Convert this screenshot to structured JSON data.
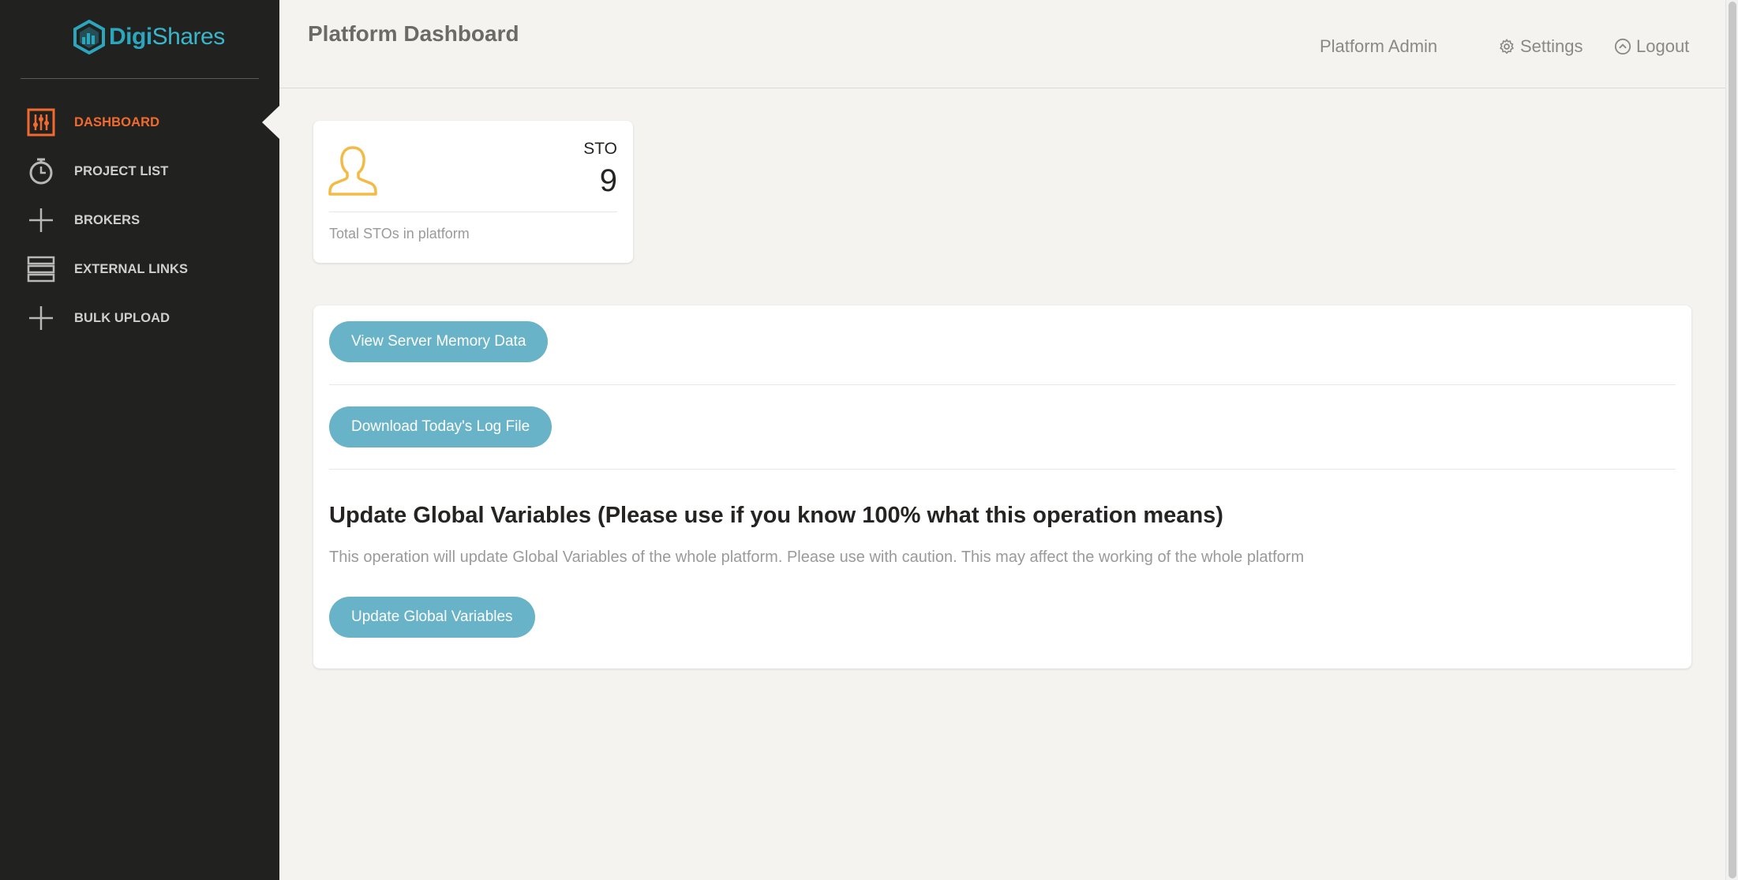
{
  "brand": {
    "name_bold": "Digi",
    "name_regular": "Shares",
    "accent_color": "#2ca6bd"
  },
  "sidebar": {
    "items": [
      {
        "label": "DASHBOARD",
        "icon": "sliders-icon",
        "active": true
      },
      {
        "label": "PROJECT LIST",
        "icon": "stopwatch-icon",
        "active": false
      },
      {
        "label": "BROKERS",
        "icon": "plus-icon",
        "active": false
      },
      {
        "label": "EXTERNAL LINKS",
        "icon": "list-icon",
        "active": false
      },
      {
        "label": "BULK UPLOAD",
        "icon": "plus-icon",
        "active": false
      }
    ],
    "active_color": "#f26a2e"
  },
  "header": {
    "title": "Platform Dashboard",
    "admin_label": "Platform Admin",
    "settings_label": "Settings",
    "logout_label": "Logout"
  },
  "stats_card": {
    "label": "STO",
    "value": "9",
    "footer": "Total STOs in platform",
    "icon": "user-icon",
    "icon_color": "#f3bb45"
  },
  "panel": {
    "memory_button": "View Server Memory Data",
    "log_button": "Download Today's Log File",
    "section_heading": "Update Global Variables (Please use if you know 100% what this operation means)",
    "section_description": "This operation will update Global Variables of the whole platform. Please use with caution. This may affect the working of the whole platform",
    "update_button": "Update Global Variables",
    "button_color": "#68b3c8"
  }
}
